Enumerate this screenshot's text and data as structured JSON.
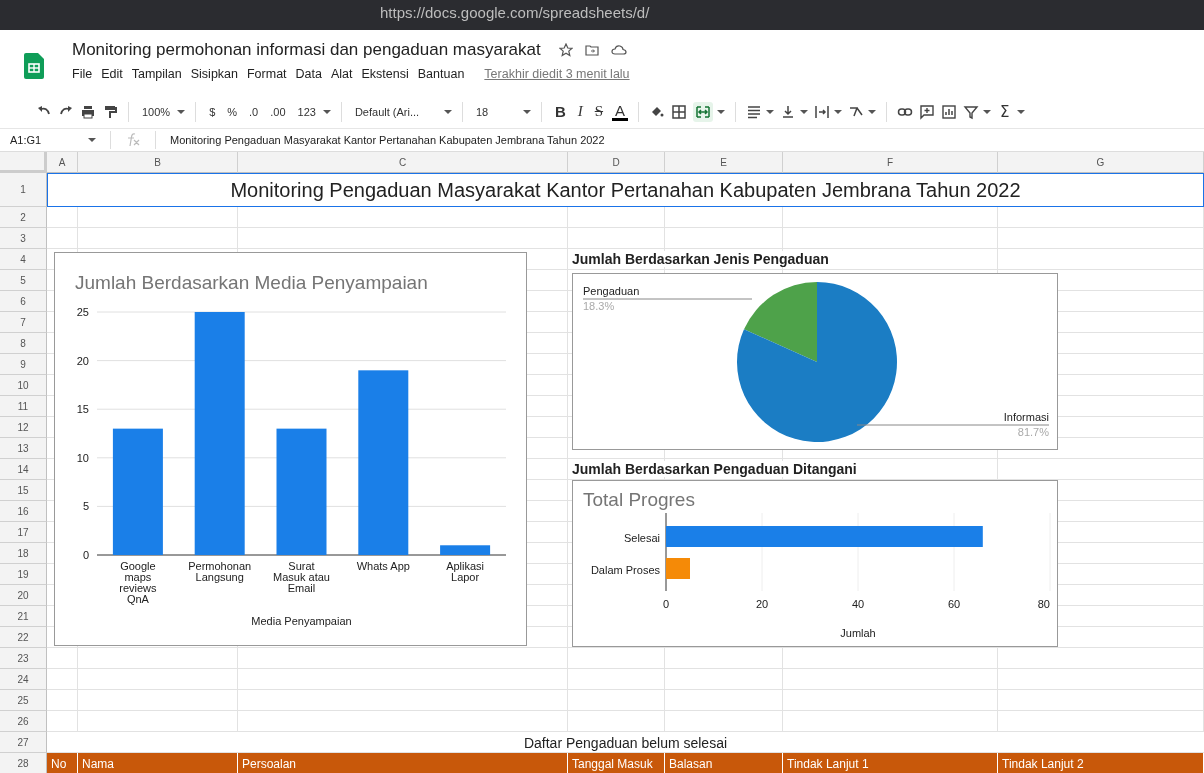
{
  "browser": {
    "url": "https://docs.google.com/spreadsheets/d/"
  },
  "document": {
    "title": "Monitoring permohonan informasi dan pengaduan masyarakat",
    "menu": [
      "File",
      "Edit",
      "Tampilan",
      "Sisipkan",
      "Format",
      "Data",
      "Alat",
      "Ekstensi",
      "Bantuan"
    ],
    "last_edit": "Terakhir diedit 3 menit lalu"
  },
  "toolbar": {
    "zoom": "100%",
    "currency": "$",
    "percent": "%",
    "decimal_less": ".0",
    "decimal_more": ".00",
    "number_format": "123",
    "font": "Default (Ari...",
    "font_size": "18",
    "bold": "B",
    "italic": "I",
    "strikethrough": "S",
    "text_color": "A",
    "merge_on": true,
    "sum": "Σ"
  },
  "formula_bar": {
    "range": "A1:G1",
    "value": "Monitoring Pengaduan Masyarakat Kantor Pertanahan Kabupaten Jembrana Tahun 2022"
  },
  "columns": [
    "A",
    "B",
    "C",
    "D",
    "E",
    "F",
    "G"
  ],
  "rows": [
    "1",
    "2",
    "3",
    "4",
    "5",
    "6",
    "7",
    "8",
    "9",
    "10",
    "11",
    "12",
    "13",
    "14",
    "15",
    "16",
    "17",
    "18",
    "19",
    "20",
    "21",
    "22",
    "23",
    "24",
    "25",
    "26",
    "27",
    "28"
  ],
  "title_row": {
    "text": "Monitoring Pengaduan Masyarakat Kantor Pertanahan Kabupaten Jembrana Tahun 2022",
    "selected": true
  },
  "list_title": "Daftar Pengaduan belum selesai",
  "table_header": {
    "color": "#c8580a",
    "cells": [
      "No",
      "Nama",
      "Persoalan",
      "Tanggal Masuk",
      "Balasan",
      "Tindak Lanjut 1",
      "Tindak Lanjut 2"
    ]
  },
  "media_chart": {
    "chart_data": {
      "type": "bar",
      "title": "Jumlah Berdasarkan Media Penyampaian",
      "xlabel": "Media Penyampaian",
      "categories": [
        "Google maps reviews QnA",
        "Permohonan Langsung",
        "Surat Masuk atau Email",
        "Whats App",
        "Aplikasi Lapor"
      ],
      "series": [
        {
          "color": "#1a7fe8",
          "values": [
            13,
            25,
            13,
            19,
            1
          ]
        }
      ],
      "ylim": [
        0,
        25
      ],
      "yticks": [
        0,
        5,
        10,
        15,
        20,
        25
      ],
      "grid": true
    }
  },
  "type_chart": {
    "heading": "Jumlah Berdasarkan Jenis Pengaduan",
    "chart_data": {
      "type": "pie",
      "categories": [
        "Pengaduan",
        "Informasi"
      ],
      "series": [
        {
          "values": [
            18.3,
            81.7
          ]
        }
      ],
      "colors": [
        "#4ea24a",
        "#1b7dc4"
      ],
      "value_labels": [
        "18.3%",
        "81.7%"
      ]
    }
  },
  "progress_chart": {
    "heading": "Jumlah Berdasarkan Pengaduan Ditangani",
    "chart_data": {
      "type": "bar",
      "orientation": "horizontal",
      "title": "Total Progres",
      "xlabel": "Jumlah",
      "categories": [
        "Selesai",
        "Dalam Proses"
      ],
      "series": [
        {
          "values": [
            66,
            5
          ]
        }
      ],
      "colors": [
        "#1a7fe8",
        "#f58a07"
      ],
      "xlim": [
        0,
        80
      ],
      "xticks": [
        0,
        20,
        40,
        60,
        80
      ],
      "grid": true
    }
  }
}
